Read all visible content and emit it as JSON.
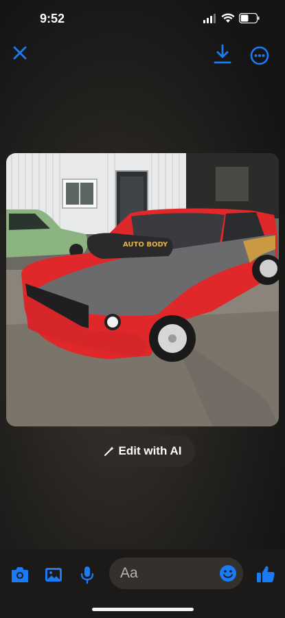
{
  "status_bar": {
    "time": "9:52"
  },
  "photo_overlay": {
    "edit_label": "Edit with AI",
    "car_sign_text": "AUTO BODY"
  },
  "composer": {
    "placeholder": "Aa"
  },
  "colors": {
    "accent": "#1a7cf5"
  }
}
